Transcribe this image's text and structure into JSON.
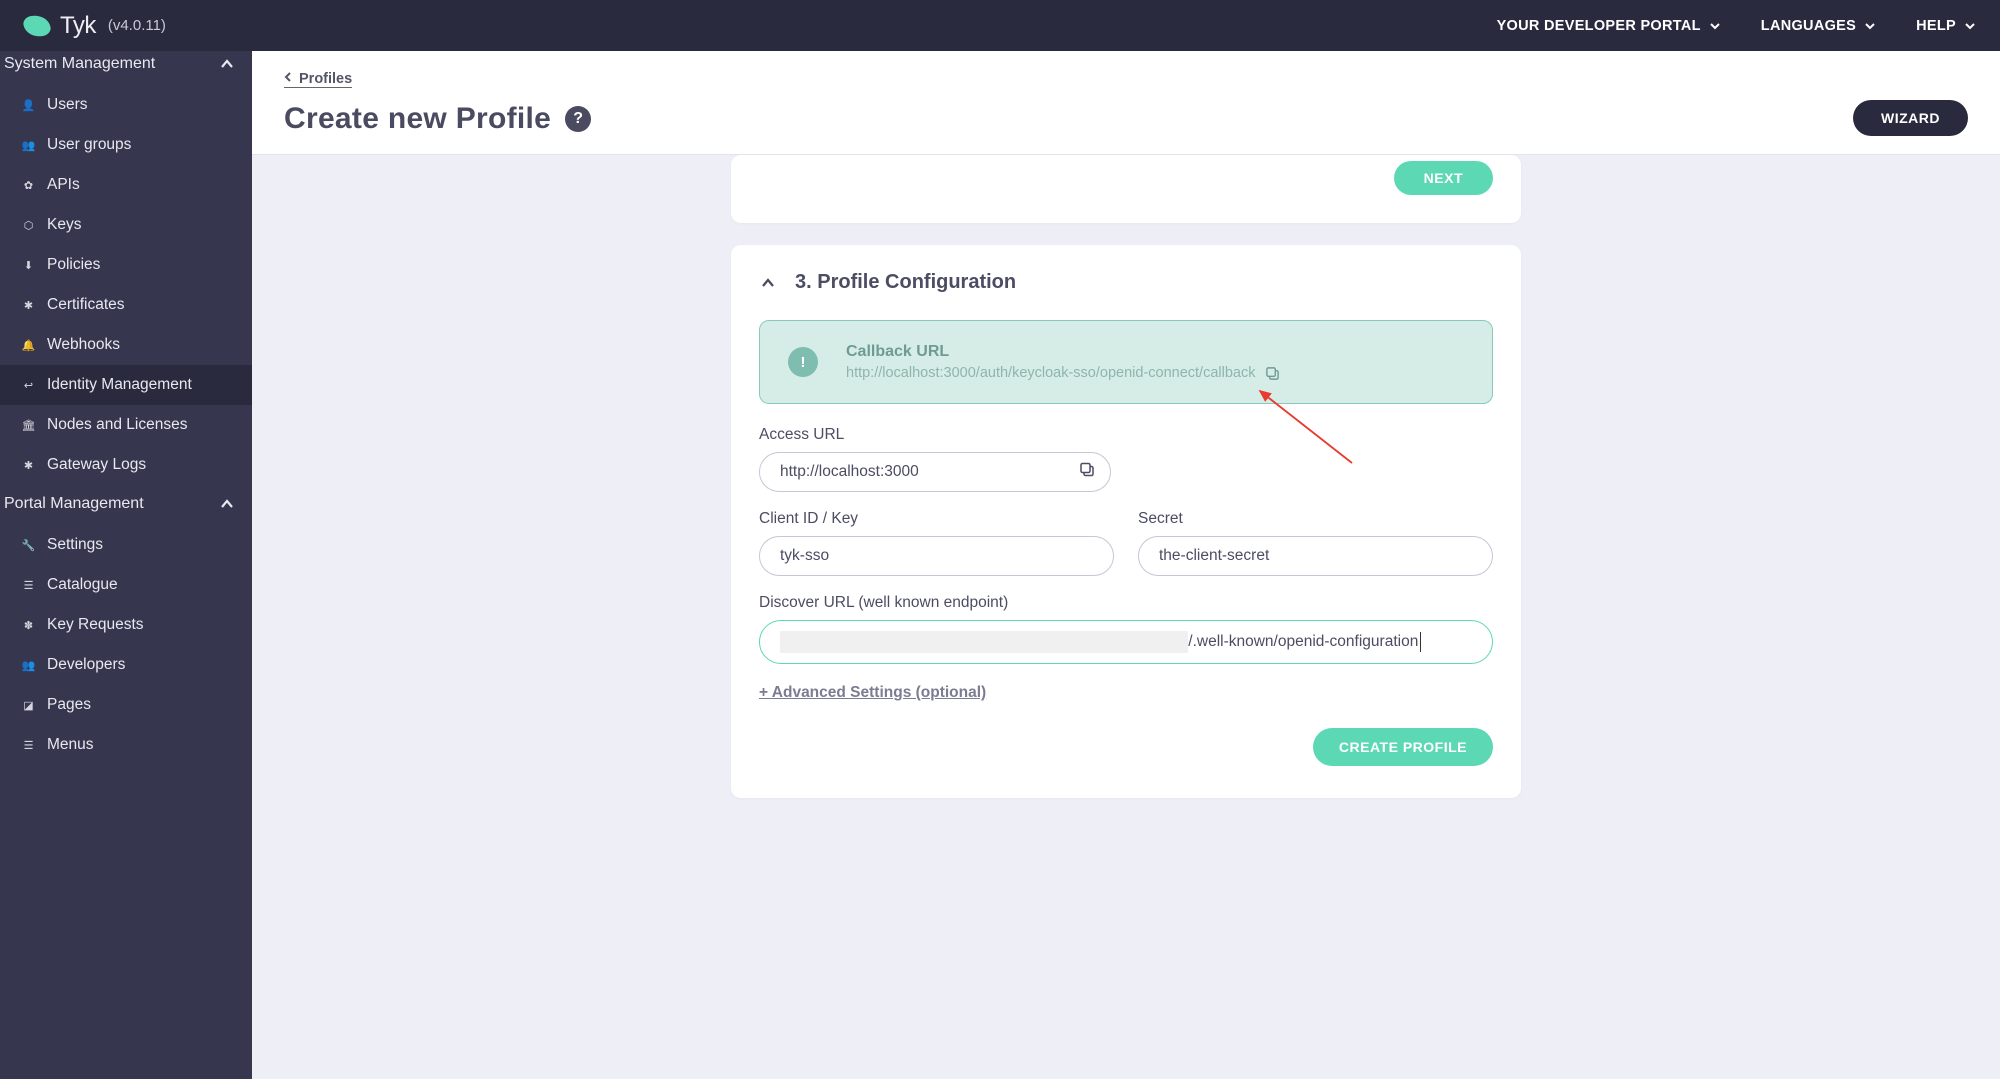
{
  "header": {
    "product": "Tyk",
    "version": "(v4.0.11)",
    "nav": [
      {
        "label": "YOUR DEVELOPER PORTAL"
      },
      {
        "label": "LANGUAGES"
      },
      {
        "label": "HELP"
      }
    ]
  },
  "sidebar": {
    "systemMgmt": {
      "label": "System Management"
    },
    "items": [
      {
        "icon": "user-icon",
        "label": "Users"
      },
      {
        "icon": "users-icon",
        "label": "User groups"
      },
      {
        "icon": "gears-icon",
        "label": "APIs"
      },
      {
        "icon": "keys-icon",
        "label": "Keys"
      },
      {
        "icon": "policies-icon",
        "label": "Policies"
      },
      {
        "icon": "certificate-icon",
        "label": "Certificates"
      },
      {
        "icon": "bell-icon",
        "label": "Webhooks"
      },
      {
        "icon": "identity-icon",
        "label": "Identity Management"
      },
      {
        "icon": "nodes-icon",
        "label": "Nodes and Licenses"
      },
      {
        "icon": "bug-icon",
        "label": "Gateway Logs"
      }
    ],
    "portalMgmt": {
      "label": "Portal Management"
    },
    "portalItems": [
      {
        "icon": "wrench-icon",
        "label": "Settings"
      },
      {
        "icon": "list-icon",
        "label": "Catalogue"
      },
      {
        "icon": "paw-icon",
        "label": "Key Requests"
      },
      {
        "icon": "group-icon",
        "label": "Developers"
      },
      {
        "icon": "page-icon",
        "label": "Pages"
      },
      {
        "icon": "menu-icon",
        "label": "Menus"
      }
    ]
  },
  "breadcrumb": {
    "label": "Profiles"
  },
  "page": {
    "title": "Create new Profile"
  },
  "buttons": {
    "wizard": "WIZARD",
    "next": "NEXT",
    "create": "CREATE PROFILE"
  },
  "section": {
    "title": "3. Profile Configuration"
  },
  "callback": {
    "title": "Callback URL",
    "url": "http://localhost:3000/auth/keycloak-sso/openid-connect/callback"
  },
  "fields": {
    "accessUrl": {
      "label": "Access URL",
      "value": "http://localhost:3000"
    },
    "clientId": {
      "label": "Client ID / Key",
      "value": "tyk-sso"
    },
    "secret": {
      "label": "Secret",
      "value": "the-client-secret"
    },
    "discover": {
      "label": "Discover URL (well known endpoint)",
      "suffix": "/.well-known/openid-configuration"
    }
  },
  "advanced": {
    "label": "+ Advanced Settings (optional)"
  }
}
